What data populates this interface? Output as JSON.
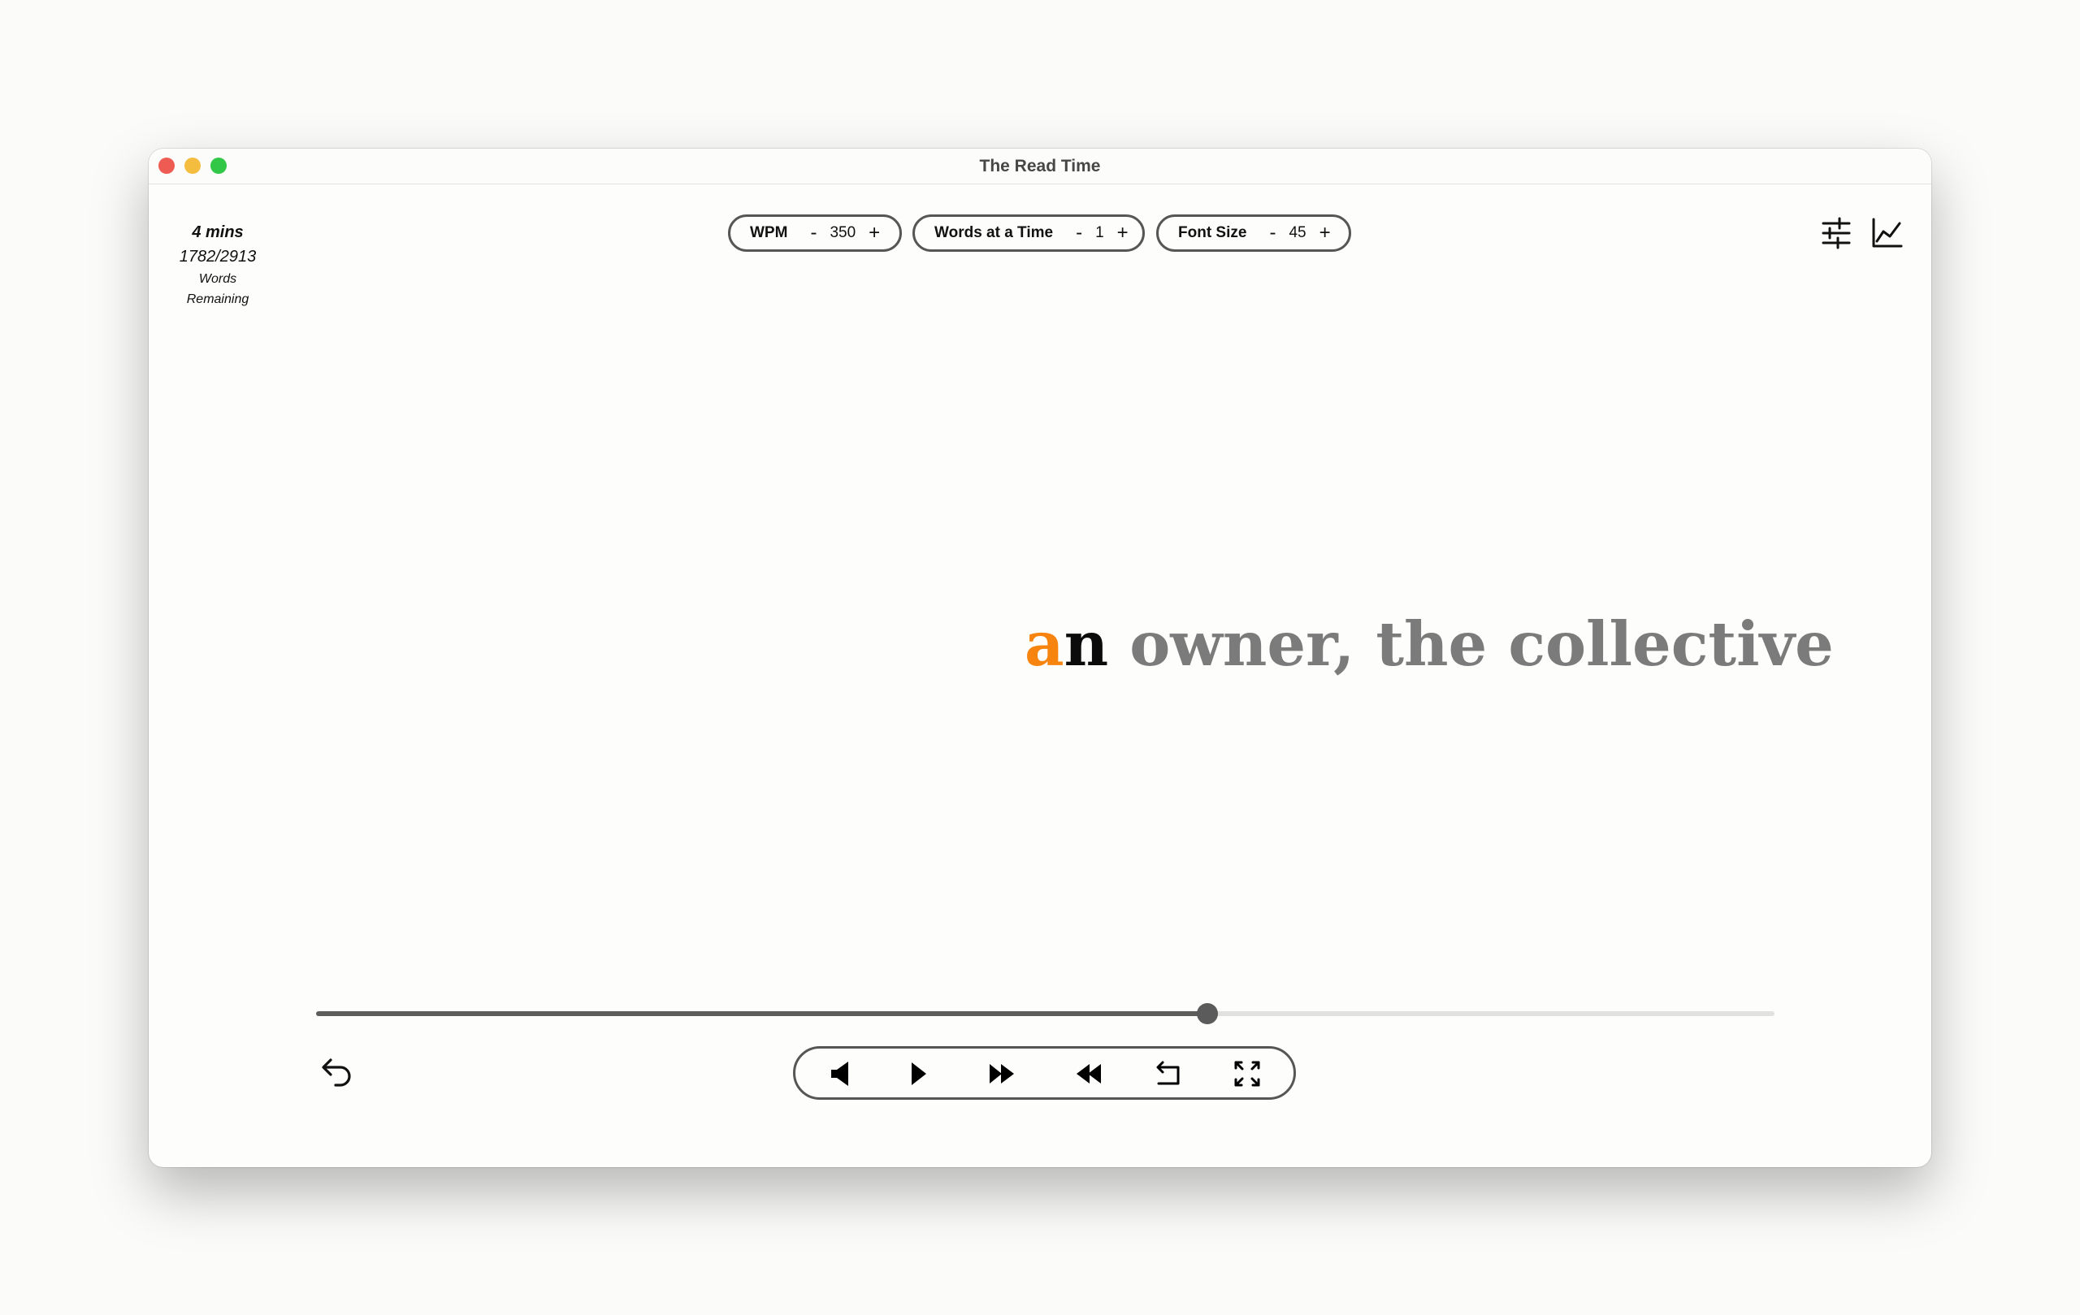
{
  "window": {
    "title": "The Read Time"
  },
  "stats": {
    "time_remaining": "4 mins",
    "word_count": "1782/2913",
    "words_label": "Words",
    "remaining_label": "Remaining"
  },
  "settings": {
    "wpm": {
      "label": "WPM",
      "minus": "-",
      "value": "350",
      "plus": "+"
    },
    "words_at_a_time": {
      "label": "Words at a Time",
      "minus": "-",
      "value": "1",
      "plus": "+"
    },
    "font_size": {
      "label": "Font Size",
      "minus": "-",
      "value": "45",
      "plus": "+"
    }
  },
  "reader": {
    "focus_letter": "a",
    "focus_rest": "n",
    "context": " owner, the collective"
  },
  "progress": {
    "fraction": 0.611
  },
  "colors": {
    "focus_letter": "#f6840f",
    "current_word": "#0b0b0b",
    "context_words": "#7b7b7b",
    "progress_fill": "#5d5d5d",
    "progress_track": "#e1e1e1"
  },
  "icons": {
    "top_right": [
      "sliders-icon",
      "line-chart-icon"
    ],
    "controls": [
      "previous-icon",
      "play-icon",
      "fast-forward-icon",
      "rewind-icon",
      "return-icon",
      "fullscreen-icon"
    ],
    "bottom_left": "undo-icon"
  }
}
